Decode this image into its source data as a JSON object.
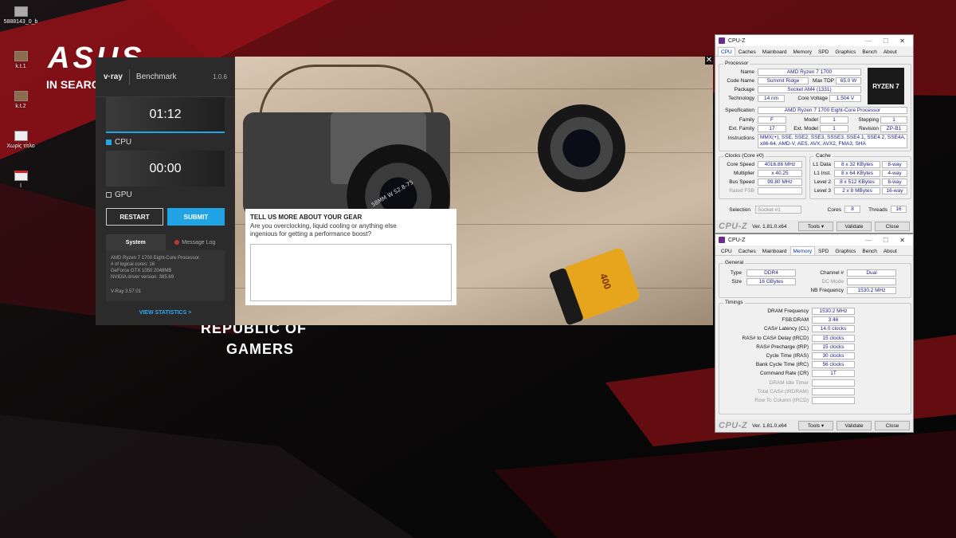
{
  "desktop": {
    "icons": [
      {
        "label": "5888143_0_b"
      },
      {
        "label": "k.t.1"
      },
      {
        "label": "k.t.2"
      },
      {
        "label": "Χωρίς τίτλο"
      },
      {
        "label": "l"
      }
    ],
    "asus_line1": "ASUS",
    "asus_line2": "IN SEARC",
    "rog_line1": "REPUBLIC OF",
    "rog_line2": "GAMERS"
  },
  "vray": {
    "logo": "v·ray",
    "title": "Benchmark",
    "version": "1.0.6",
    "cpu_time": "01:12",
    "cpu_label": "CPU",
    "gpu_time": "00:00",
    "gpu_label": "GPU",
    "restart": "RESTART",
    "submit": "SUBMIT",
    "tab_system": "System",
    "tab_log": "Message Log",
    "sys_lines": [
      "AMD Ryzen 7 1700 Eight-Core Processor.",
      "# of logical cores: 16",
      "GeForce GTX 1050 2048MB",
      "NVIDIA driver version: 385.69"
    ],
    "vray_version": "V-Ray 3.57.01",
    "view_stats": "VIEW STATISTICS >"
  },
  "survey": {
    "question": "TELL US MORE ABOUT YOUR GEAR",
    "sub1": "Are you overclocking, liquid cooling or anything else",
    "sub2": "ingenious for getting a performance boost?",
    "value": ""
  },
  "photo": {
    "lens_text": "58MM W S2.8-75",
    "film_text": "400"
  },
  "cpuz_top": {
    "title": "CPU-Z",
    "tabs": [
      "CPU",
      "Caches",
      "Mainboard",
      "Memory",
      "SPD",
      "Graphics",
      "Bench",
      "About"
    ],
    "active_tab": "CPU",
    "processor_label": "Processor",
    "name_l": "Name",
    "name": "AMD Ryzen 7 1700",
    "codename_l": "Code Name",
    "codename": "Summit Ridge",
    "maxtdp_l": "Max TDP",
    "maxtdp": "65.0 W",
    "package_l": "Package",
    "package": "Socket AM4 (1331)",
    "tech_l": "Technology",
    "tech": "14 nm",
    "cvolt_l": "Core Voltage",
    "cvolt": "1.504 V",
    "spec_l": "Specification",
    "spec": "AMD Ryzen 7 1700 Eight-Core Processor",
    "family_l": "Family",
    "family": "F",
    "model_l": "Model",
    "model": "1",
    "stepping_l": "Stepping",
    "stepping": "1",
    "extfam_l": "Ext. Family",
    "extfam": "17",
    "extmod_l": "Ext. Model",
    "extmod": "1",
    "rev_l": "Revision",
    "rev": "ZP-B1",
    "instr_l": "Instructions",
    "instr1": "MMX(+), SSE, SSE2, SSE3, SSSE3, SSE4.1, SSE4.2, SSE4A,",
    "instr2": "x86-64, AMD-V, AES, AVX, AVX2, FMA3, SHA",
    "clocks_label": "Clocks (Core #0)",
    "cache_label": "Cache",
    "cspeed_l": "Core Speed",
    "cspeed": "4016.86 MHz",
    "mult_l": "Multiplier",
    "mult": "x 40.25",
    "bus_l": "Bus Speed",
    "bus": "99.80 MHz",
    "fsb_l": "Rated FSB",
    "fsb": "",
    "l1d_l": "L1 Data",
    "l1d": "8 x 32 KBytes",
    "l1d_w": "8-way",
    "l1i_l": "L1 Inst.",
    "l1i": "8 x 64 KBytes",
    "l1i_w": "4-way",
    "l2_l": "Level 2",
    "l2": "8 x 512 KBytes",
    "l2_w": "8-way",
    "l3_l": "Level 3",
    "l3": "2 x 8 MBytes",
    "l3_w": "16-way",
    "selection_l": "Selection",
    "selection": "Socket #1",
    "cores_l": "Cores",
    "cores": "8",
    "threads_l": "Threads",
    "threads": "16",
    "amd_logo": "RYZEN 7",
    "brand": "CPU-Z",
    "version": "Ver. 1.81.0.x64",
    "tools": "Tools",
    "validate": "Validate",
    "close": "Close"
  },
  "cpuz_bot": {
    "title": "CPU-Z",
    "tabs": [
      "CPU",
      "Caches",
      "Mainboard",
      "Memory",
      "SPD",
      "Graphics",
      "Bench",
      "About"
    ],
    "active_tab": "Memory",
    "general_label": "General",
    "type_l": "Type",
    "type": "DDR4",
    "channel_l": "Channel #",
    "channel": "Dual",
    "size_l": "Size",
    "size": "16 GBytes",
    "dcmode_l": "DC Mode",
    "dcmode": "",
    "nbfreq_l": "NB Frequency",
    "nbfreq": "1530.2 MHz",
    "timings_label": "Timings",
    "timings": [
      {
        "l": "DRAM Frequency",
        "v": "1530.2 MHz",
        "dis": false
      },
      {
        "l": "FSB:DRAM",
        "v": "3:46",
        "dis": false
      },
      {
        "l": "CAS# Latency (CL)",
        "v": "14.0 clocks",
        "dis": false
      },
      {
        "l": "RAS# to CAS# Delay (tRCD)",
        "v": "15 clocks",
        "dis": false
      },
      {
        "l": "RAS# Precharge (tRP)",
        "v": "15 clocks",
        "dis": false
      },
      {
        "l": "Cycle Time (tRAS)",
        "v": "30 clocks",
        "dis": false
      },
      {
        "l": "Bank Cycle Time (tRC)",
        "v": "56 clocks",
        "dis": false
      },
      {
        "l": "Command Rate (CR)",
        "v": "1T",
        "dis": false
      },
      {
        "l": "DRAM Idle Timer",
        "v": "",
        "dis": true
      },
      {
        "l": "Total CAS# (tRDRAM)",
        "v": "",
        "dis": true
      },
      {
        "l": "Row To Column (tRCD)",
        "v": "",
        "dis": true
      }
    ],
    "brand": "CPU-Z",
    "version": "Ver. 1.81.0.x64",
    "tools": "Tools",
    "validate": "Validate",
    "close": "Close"
  }
}
